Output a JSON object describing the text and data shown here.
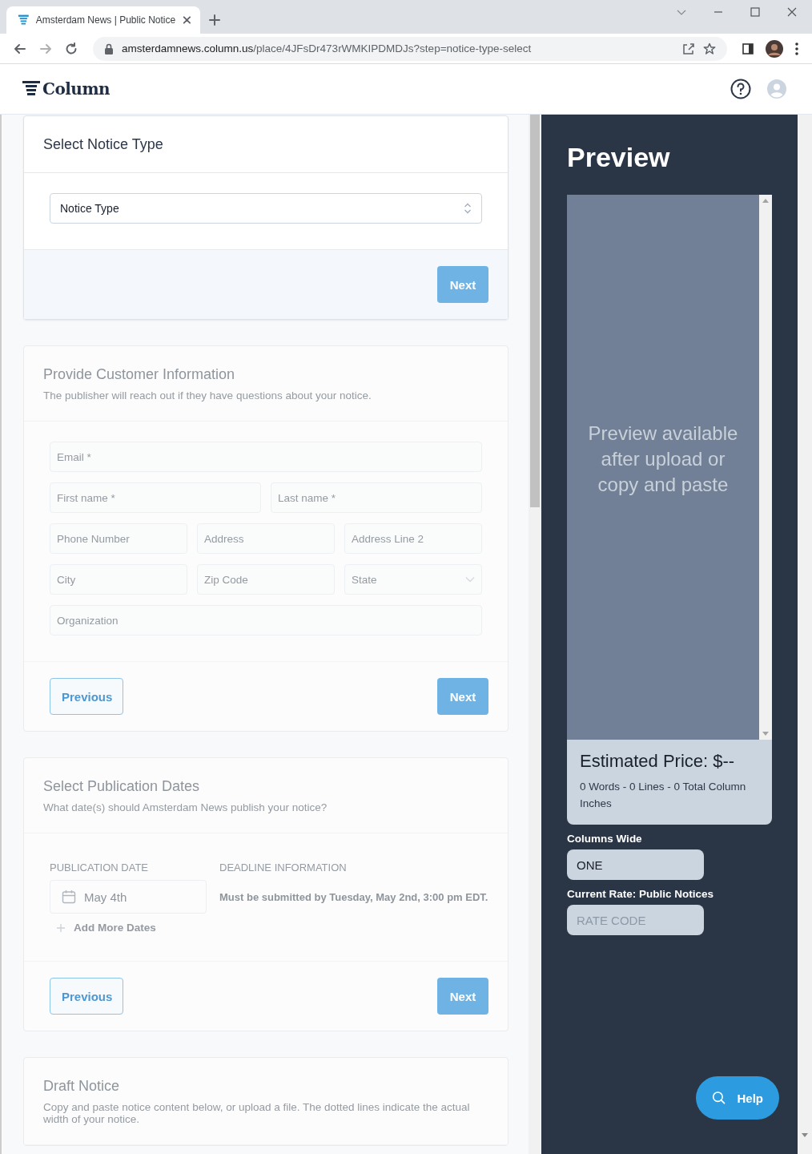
{
  "browser": {
    "tab_title": "Amsterdam News | Public Notice",
    "url_host": "amsterdamnews.column.us",
    "url_path": "/place/4JFsDr473rWMKIPDMDJs?step=notice-type-select"
  },
  "header": {
    "logo": "Column"
  },
  "steps": [
    {
      "kind": "select",
      "title": "Select Notice Type",
      "disabled": false,
      "select": {
        "placeholder": "Notice Type"
      },
      "buttons": [
        {
          "label": "Next",
          "kind": "next",
          "disabled": true
        }
      ]
    },
    {
      "kind": "form",
      "title": "Provide Customer Information",
      "subtitle": "The publisher will reach out if they have questions about your notice.",
      "disabled": true,
      "rows": [
        {
          "fields": [
            {
              "kind": "text",
              "placeholder": "Email *"
            }
          ]
        },
        {
          "fields": [
            {
              "kind": "text",
              "placeholder": "First name *"
            },
            {
              "kind": "text",
              "placeholder": "Last name *"
            }
          ]
        },
        {
          "fields": [
            {
              "kind": "text",
              "placeholder": "Phone Number"
            },
            {
              "kind": "text",
              "placeholder": "Address"
            },
            {
              "kind": "text",
              "placeholder": "Address Line 2"
            }
          ]
        },
        {
          "fields": [
            {
              "kind": "text",
              "placeholder": "City"
            },
            {
              "kind": "text",
              "placeholder": "Zip Code"
            },
            {
              "kind": "select",
              "placeholder": "State"
            }
          ]
        },
        {
          "fields": [
            {
              "kind": "text",
              "placeholder": "Organization"
            }
          ]
        }
      ],
      "buttons": [
        {
          "label": "Previous",
          "kind": "previous",
          "disabled": false
        },
        {
          "label": "Next",
          "kind": "next",
          "disabled": true
        }
      ]
    },
    {
      "kind": "dates",
      "title": "Select Publication Dates",
      "subtitle": "What date(s) should Amsterdam News publish your notice?",
      "disabled": true,
      "date_label": "PUBLICATION DATE",
      "deadline_label": "DEADLINE INFORMATION",
      "date": "May 4th",
      "deadline": "Must be submitted by Tuesday, May 2nd, 3:00 pm EDT.",
      "add_link": "Add More Dates",
      "buttons": [
        {
          "label": "Previous",
          "kind": "previous",
          "disabled": false
        },
        {
          "label": "Next",
          "kind": "next",
          "disabled": true
        }
      ]
    },
    {
      "kind": "draft",
      "title": "Draft Notice",
      "subtitle": "Copy and paste notice content below, or upload a file. The dotted lines indicate the actual width of your notice.",
      "disabled": true
    }
  ],
  "preview": {
    "title": "Preview",
    "placeholder": "Preview available after upload or copy and paste",
    "price": "Estimated Price: $--",
    "stats": "0 Words - 0 Lines - 0 Total Column Inches",
    "columns_label": "Columns Wide",
    "columns_value": "ONE",
    "rate_label": "Current Rate: Public Notices",
    "rate_placeholder": "RATE CODE"
  },
  "help": {
    "label": "Help"
  }
}
